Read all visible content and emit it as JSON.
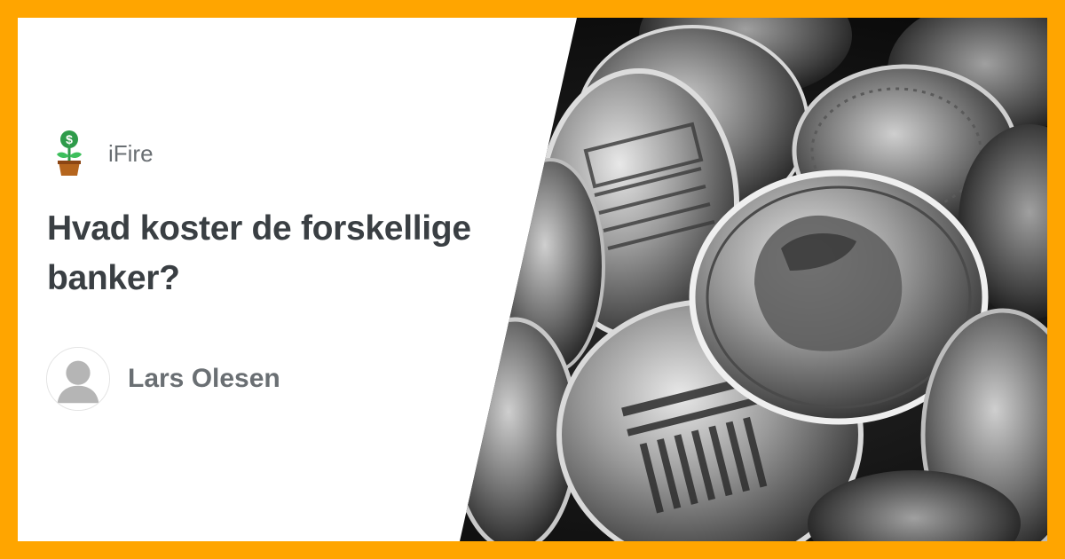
{
  "brand": {
    "name": "iFire",
    "logo_icon": "money-plant-icon"
  },
  "article": {
    "title": "Hvad koster de forskellige banker?"
  },
  "author": {
    "name": "Lars Olesen",
    "avatar_icon": "user-avatar-icon"
  },
  "photo": {
    "icon": "coins-photo"
  },
  "colors": {
    "frame": "#FFA500",
    "card": "#FFFFFF",
    "title_text": "#3A3F43",
    "muted_text": "#6A6F73",
    "logo_green": "#2E9B4A",
    "logo_pot": "#B5651D"
  }
}
